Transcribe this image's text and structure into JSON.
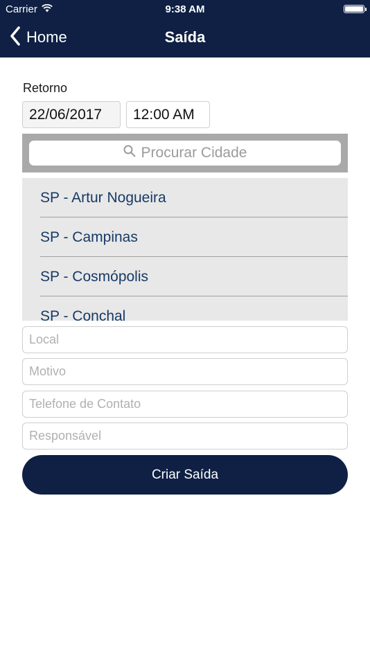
{
  "status_bar": {
    "carrier": "Carrier",
    "time": "9:38 AM"
  },
  "nav": {
    "back_label": "Home",
    "title": "Saída"
  },
  "form": {
    "retorno_label": "Retorno",
    "date_value": "22/06/2017",
    "time_value": "12:00 AM",
    "search_placeholder": "Procurar Cidade",
    "cities": [
      "SP - Artur Nogueira",
      "SP - Campinas",
      "SP - Cosmópolis",
      "SP - Conchal"
    ],
    "local_placeholder": "Local",
    "motivo_placeholder": "Motivo",
    "telefone_placeholder": "Telefone de Contato",
    "responsavel_placeholder": "Responsável",
    "submit_label": "Criar Saída"
  },
  "colors": {
    "navy": "#0f2044",
    "city_text": "#173a66"
  },
  "icons": {
    "back": "chevron-left-icon",
    "search": "search-icon",
    "wifi": "wifi-icon",
    "battery": "battery-icon"
  }
}
